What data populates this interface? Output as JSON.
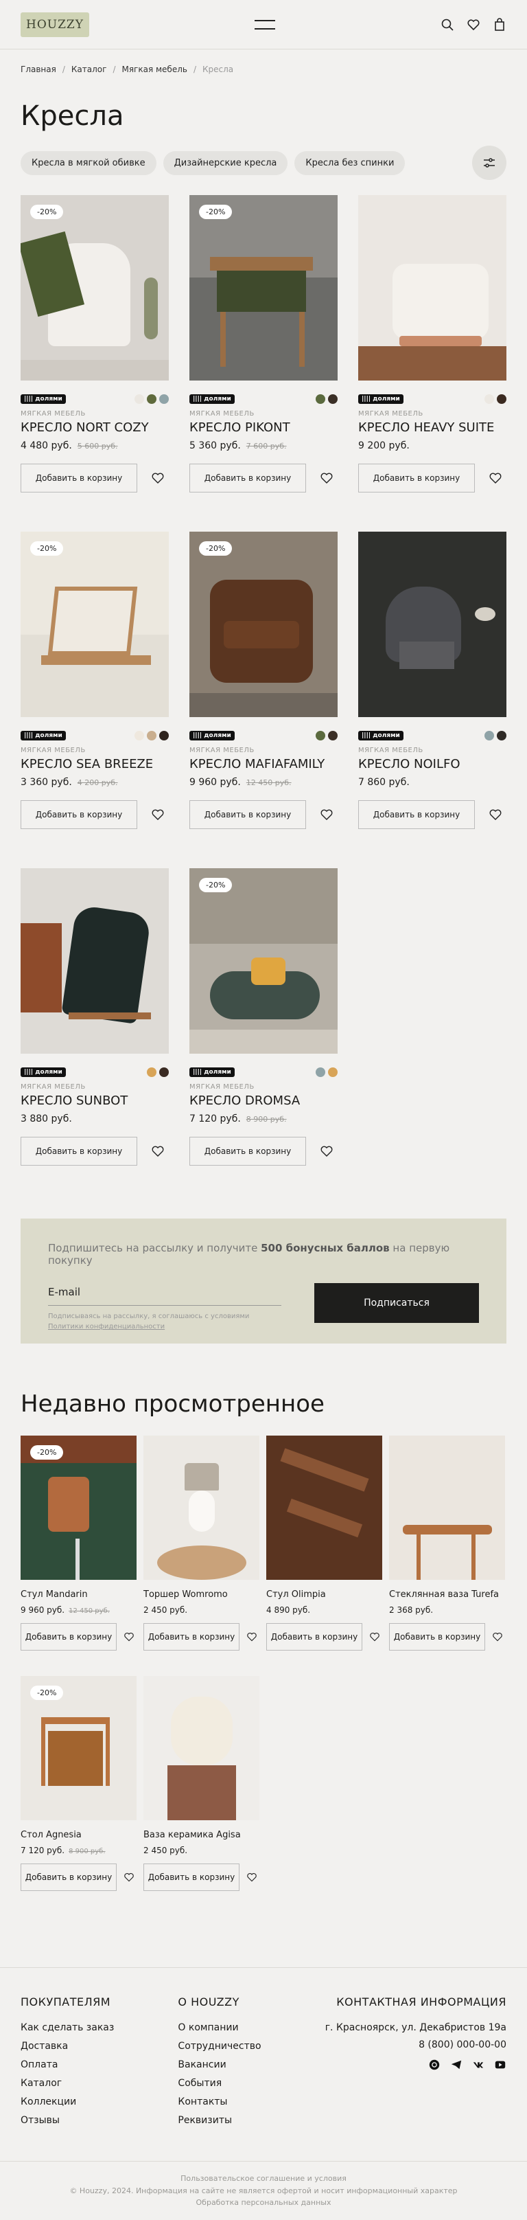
{
  "header": {
    "logo": "HOUZZY"
  },
  "breadcrumb": [
    "Главная",
    "Каталог",
    "Мягкая мебель",
    "Кресла"
  ],
  "title": "Кресла",
  "chips": [
    "Кресла в мягкой обивке",
    "Дизайнерские кресла",
    "Кресла без спинки"
  ],
  "cart_label": "Добавить в корзину",
  "dolyami": "|||| долями",
  "products": [
    {
      "disc": "-20%",
      "cat": "МЯГКАЯ МЕБЕЛЬ",
      "name": "КРЕСЛО NORT COZY",
      "price": "4 480 руб.",
      "old": "5 600 руб.",
      "colors": [
        "#ebe7e1",
        "#5f6a3c",
        "#8fa3a7"
      ]
    },
    {
      "disc": "-20%",
      "cat": "МЯГКАЯ МЕБЕЛЬ",
      "name": "КРЕСЛО PIKONT",
      "price": "5 360 руб.",
      "old": "7 600 руб.",
      "colors": [
        "#5b6a3e",
        "#3b2f26"
      ]
    },
    {
      "disc": "",
      "cat": "МЯГКАЯ МЕБЕЛЬ",
      "name": "КРЕСЛО HEAVY SUITE",
      "price": "9 200 руб.",
      "old": "",
      "colors": [
        "#ece8e2",
        "#3b2a20"
      ]
    },
    {
      "disc": "-20%",
      "cat": "МЯГКАЯ МЕБЕЛЬ",
      "name": "КРЕСЛО SEA BREEZE",
      "price": "3 360 руб.",
      "old": "4 200 руб.",
      "colors": [
        "#efe8de",
        "#c9ae8e",
        "#2f241e"
      ]
    },
    {
      "disc": "-20%",
      "cat": "МЯГКАЯ МЕБЕЛЬ",
      "name": "КРЕСЛО MAFIAFAMILY",
      "price": "9 960 руб.",
      "old": "12 450 руб.",
      "colors": [
        "#5b6a3e",
        "#3b2f26"
      ]
    },
    {
      "disc": "",
      "cat": "МЯГКАЯ МЕБЕЛЬ",
      "name": "КРЕСЛО NOILFO",
      "price": "7 860 руб.",
      "old": "",
      "colors": [
        "#8fa3a7",
        "#2f2a26"
      ]
    },
    {
      "disc": "",
      "cat": "МЯГКАЯ МЕБЕЛЬ",
      "name": "КРЕСЛО SUNBOT",
      "price": "3 880 руб.",
      "old": "",
      "colors": [
        "#d8a457",
        "#3a2a22"
      ]
    },
    {
      "disc": "-20%",
      "cat": "МЯГКАЯ МЕБЕЛЬ",
      "name": "КРЕСЛО DROMSA",
      "price": "7 120 руб.",
      "old": "8 900 руб.",
      "colors": [
        "#8fa3a7",
        "#d8a457"
      ]
    }
  ],
  "newsletter": {
    "text_a": "Подпишитесь на рассылку и получите ",
    "text_b": "500 бонусных баллов",
    "text_c": " на первую покупку",
    "email": "E-mail",
    "small": "Подписываясь на рассылку, я соглашаюсь с условиями",
    "link": "Политики конфиденциальности",
    "button": "Подписаться"
  },
  "recent_title": "Недавно просмотренное",
  "recent": [
    {
      "disc": "-20%",
      "name": "Стул Mandarin",
      "price": "9 960 руб.",
      "old": "12 450 руб."
    },
    {
      "disc": "",
      "name": "Торшер Womromo",
      "price": "2 450 руб.",
      "old": ""
    },
    {
      "disc": "",
      "name": "Стул Olimpia",
      "price": "4 890 руб.",
      "old": ""
    },
    {
      "disc": "",
      "name": "Стеклянная ваза Turefa",
      "price": "2 368 руб.",
      "old": ""
    },
    {
      "disc": "-20%",
      "name": "Стол Agnesia",
      "price": "7 120 руб.",
      "old": "8 900 руб."
    },
    {
      "disc": "",
      "name": "Ваза керамика Agisa",
      "price": "2 450 руб.",
      "old": ""
    }
  ],
  "footer": {
    "col1_title": "ПОКУПАТЕЛЯМ",
    "col1": [
      "Как сделать заказ",
      "Доставка",
      "Оплата",
      "Каталог",
      "Коллекции",
      "Отзывы"
    ],
    "col2_title": "О HOUZZY",
    "col2": [
      "О компании",
      "Сотрудничество",
      "Вакансии",
      "События",
      "Контакты",
      "Реквизиты"
    ],
    "col3_title": "КОНТАКТНАЯ ИНФОРМАЦИЯ",
    "address": "г. Красноярск, ул. Декабристов 19а",
    "phone": "8 (800) 000-00-00"
  },
  "bottom": [
    "Пользовательское соглашение и условия",
    "© Houzzy, 2024. Информация на сайте не является офертой и носит информационный характер",
    "Обработка персональных данных"
  ]
}
